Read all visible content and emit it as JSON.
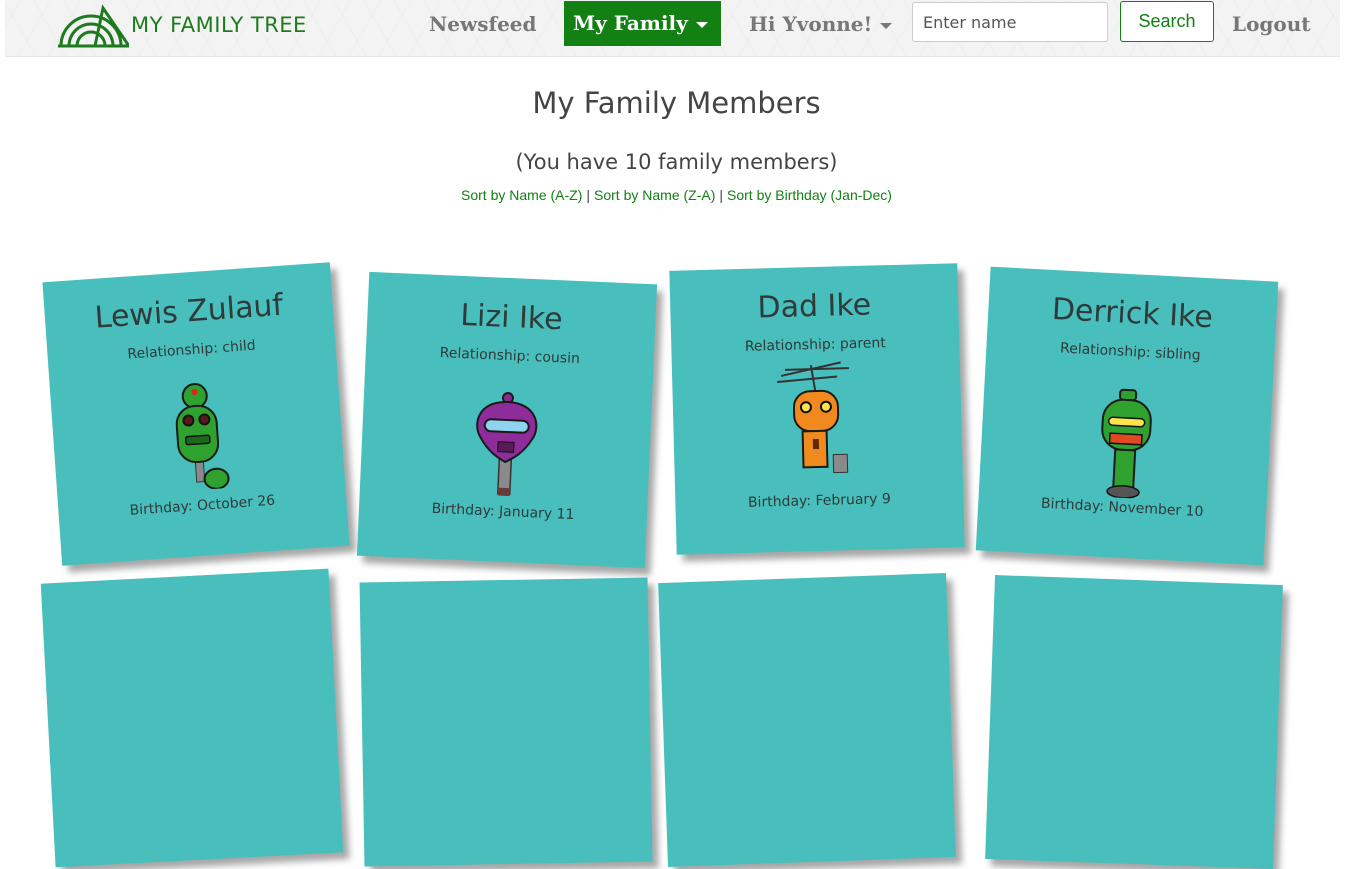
{
  "navbar": {
    "brand": "MY FAMILY TREE",
    "newsfeed": "Newsfeed",
    "my_family": "My Family",
    "greeting": "Hi Yvonne!",
    "search_placeholder": "Enter name",
    "search_label": "Search",
    "logout": "Logout",
    "accent": "#128012"
  },
  "page": {
    "title": "My Family Members",
    "subtitle": "(You have 10 family members)",
    "sort_links": [
      "Sort by Name (A-Z)",
      "Sort by Name (Z-A)",
      "Sort by Birthday (Jan-Dec)"
    ],
    "sort_separator": "|"
  },
  "members": [
    {
      "name": "Lewis Zulauf",
      "relationship": "Relationship: child",
      "birthday": "Birthday: October 26",
      "robot_icon": "green-robot-icon"
    },
    {
      "name": "Lizi Ike",
      "relationship": "Relationship: cousin",
      "birthday": "Birthday: January 11",
      "robot_icon": "purple-robot-icon"
    },
    {
      "name": "Dad Ike",
      "relationship": "Relationship: parent",
      "birthday": "Birthday: February 9",
      "robot_icon": "orange-robot-icon"
    },
    {
      "name": "Derrick Ike",
      "relationship": "Relationship: sibling",
      "birthday": "Birthday: November 10",
      "robot_icon": "green-robot-icon"
    }
  ],
  "colors": {
    "card": "#48bfbc",
    "text": "#444444"
  }
}
